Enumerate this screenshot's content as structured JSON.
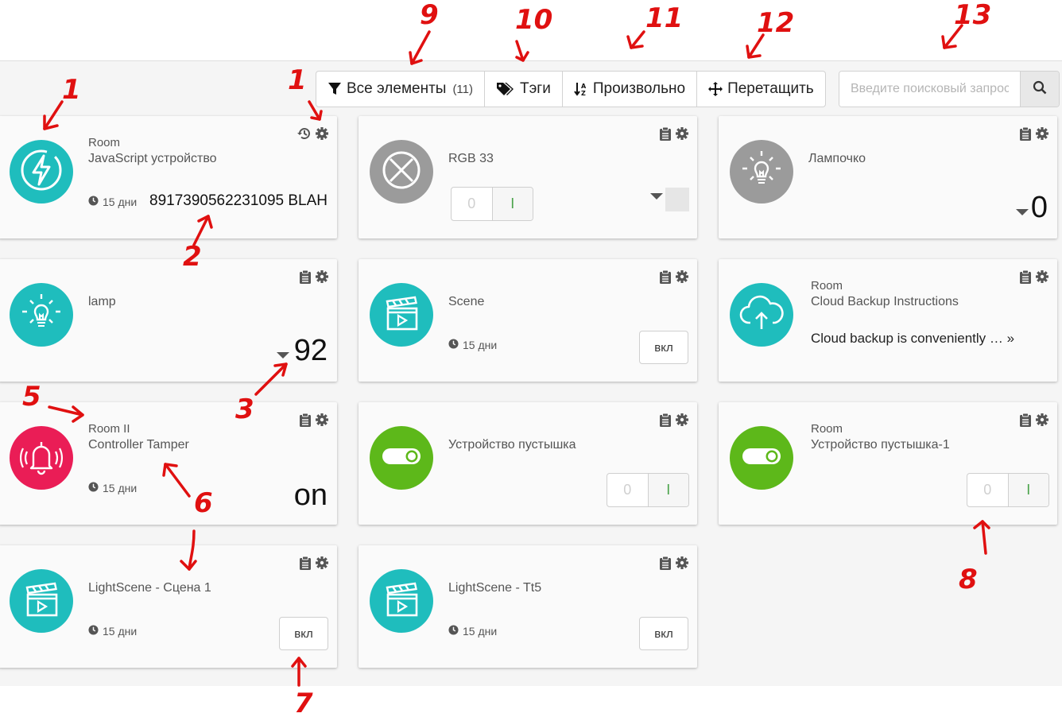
{
  "toolbar": {
    "all_items_label": "Все элементы",
    "all_items_count": "(11)",
    "tags_label": "Тэги",
    "sort_label": "Произвольно",
    "drag_label": "Перетащить"
  },
  "search": {
    "placeholder": "Введите поисковый запрос"
  },
  "cards": [
    {
      "room": "Room",
      "title": "JavaScript устройство",
      "time": "15 дни",
      "value": "8917390562231095 BLAH",
      "icon": "lightning-icon",
      "color": "#1fbdbd"
    },
    {
      "title": "RGB 33",
      "toggle_off": "0",
      "toggle_on": "I",
      "icon": "disabled-circle-x-icon",
      "color": "#9b9b9b"
    },
    {
      "title": "Лампочко",
      "value": "0",
      "icon": "light-bulb-icon",
      "color": "#9b9b9b"
    },
    {
      "title": "lamp",
      "value": "92",
      "icon": "light-bulb-icon",
      "color": "#1fbdbd"
    },
    {
      "title": "Scene",
      "time": "15 дни",
      "button": "вкл",
      "icon": "clapperboard-icon",
      "color": "#1fbdbd"
    },
    {
      "room": "Room",
      "title": "Cloud Backup Instructions",
      "description": "Cloud backup is conveniently … »",
      "icon": "cloud-upload-icon",
      "color": "#1fbdbd"
    },
    {
      "room": "Room II",
      "title": "Controller Tamper",
      "time": "15 дни",
      "value": "on",
      "icon": "alarm-bell-icon",
      "color": "#ea1d56"
    },
    {
      "title": "Устройство пустышка",
      "toggle_off": "0",
      "toggle_on": "I",
      "icon": "toggle-switch-icon",
      "color": "#5db81a"
    },
    {
      "room": "Room",
      "title": "Устройство пустышка-1",
      "toggle_off": "0",
      "toggle_on": "I",
      "icon": "toggle-switch-icon",
      "color": "#5db81a"
    },
    {
      "title": "LightScene - Сцена 1",
      "time": "15 дни",
      "button": "вкл",
      "icon": "clapperboard-icon",
      "color": "#1fbdbd"
    },
    {
      "title": "LightScene - Tt5",
      "time": "15 дни",
      "button": "вкл",
      "icon": "clapperboard-icon",
      "color": "#1fbdbd"
    }
  ],
  "annotations": [
    "1",
    "1",
    "2",
    "3",
    "5",
    "6",
    "7",
    "8",
    "9",
    "10",
    "11",
    "12",
    "13"
  ]
}
